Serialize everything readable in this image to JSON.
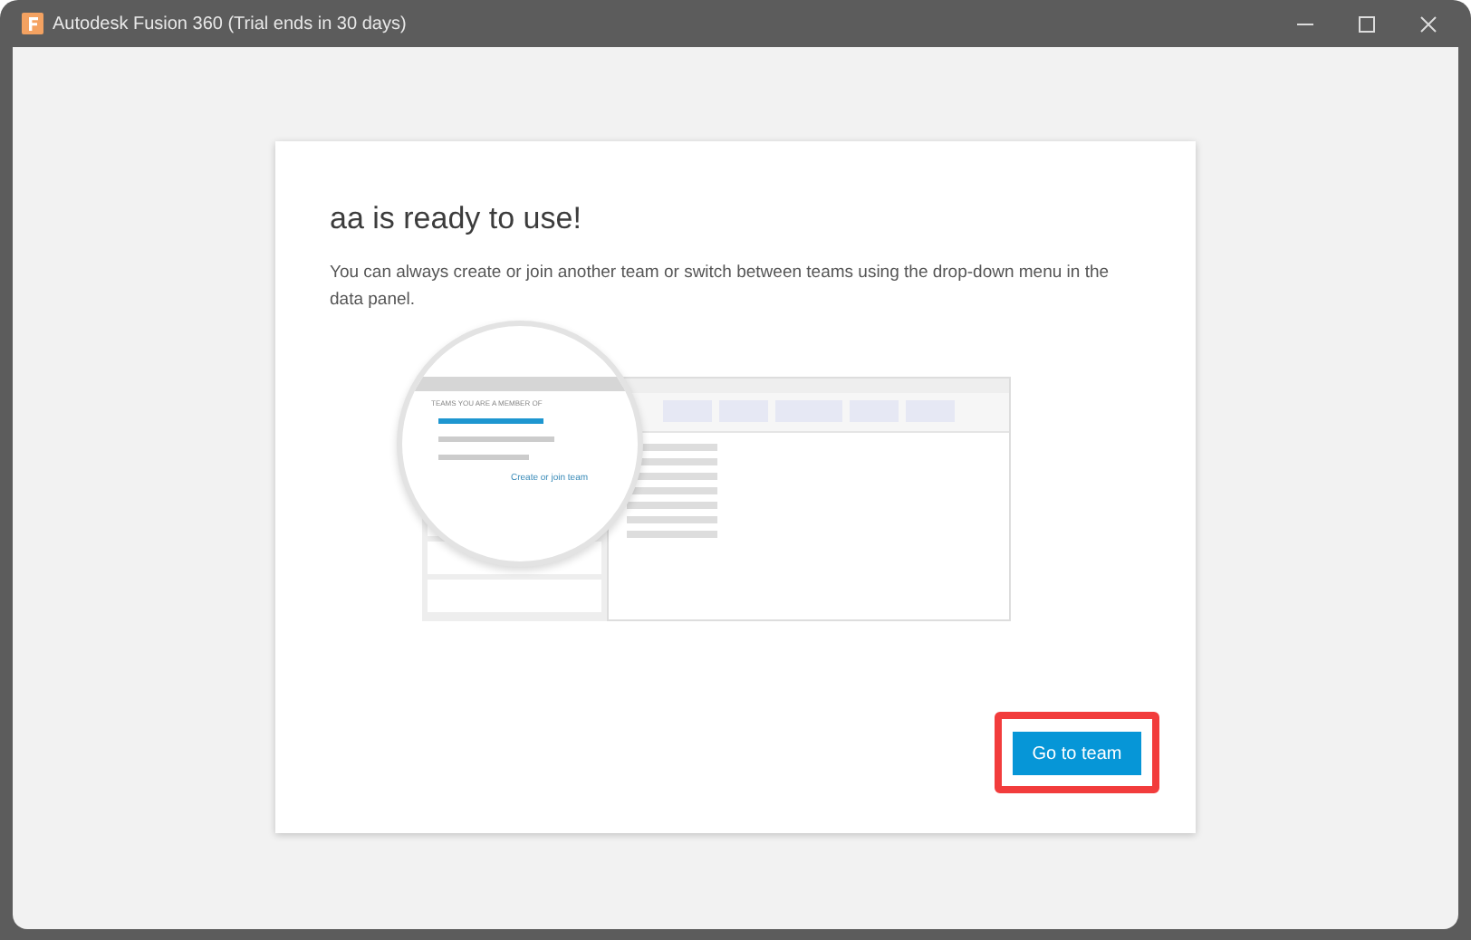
{
  "window": {
    "title": "Autodesk Fusion 360 (Trial ends in 30 days)"
  },
  "dialog": {
    "heading": "aa is ready to use!",
    "description": "You can always create or join another team or switch between teams using the drop-down menu in the data panel.",
    "illustration": {
      "menu_heading": "TEAMS YOU ARE A MEMBER OF",
      "menu_link": "Create or join team"
    },
    "button": {
      "label": "Go to team",
      "highlighted": true
    }
  }
}
